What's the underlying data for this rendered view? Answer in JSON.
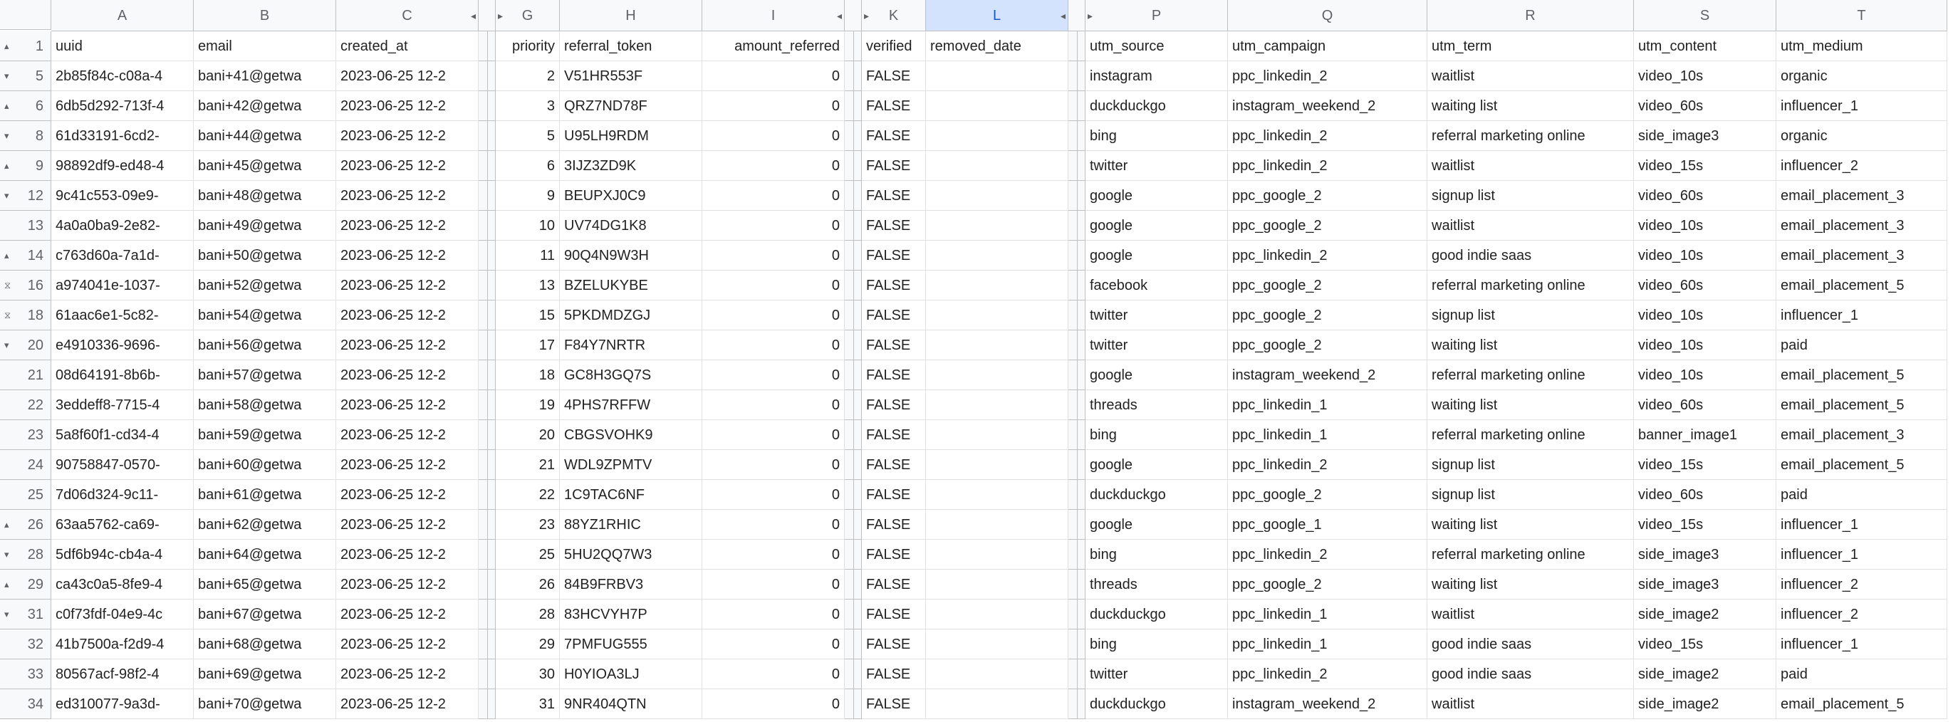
{
  "columns": [
    {
      "letter": "",
      "width": "corner"
    },
    {
      "letter": "A"
    },
    {
      "letter": "B"
    },
    {
      "letter": "C",
      "rcaret": "◂"
    },
    {
      "letter": "",
      "edge": "r"
    },
    {
      "letter": "",
      "edge": "l"
    },
    {
      "letter": "G",
      "lcaret": "▸"
    },
    {
      "letter": "H"
    },
    {
      "letter": "I",
      "rcaret": "◂"
    },
    {
      "letter": "",
      "edge": "r"
    },
    {
      "letter": "",
      "edge": "l"
    },
    {
      "letter": "K",
      "lcaret": "▸"
    },
    {
      "letter": "L",
      "rcaret": "◂",
      "selected": true
    },
    {
      "letter": "",
      "edge": "r"
    },
    {
      "letter": "",
      "edge": "l"
    },
    {
      "letter": "P",
      "lcaret": "▸"
    },
    {
      "letter": "Q"
    },
    {
      "letter": "R"
    },
    {
      "letter": "S"
    },
    {
      "letter": "T"
    }
  ],
  "rows": [
    {
      "num": "1",
      "mark": "▴",
      "cells": [
        "uuid",
        "email",
        "created_at",
        "",
        "",
        "priority",
        "referral_token",
        "amount_referred",
        "",
        "",
        "verified",
        "removed_date",
        "",
        "",
        "utm_source",
        "utm_campaign",
        "utm_term",
        "utm_content",
        "utm_medium"
      ]
    },
    {
      "num": "5",
      "mark": "▾",
      "cells": [
        "2b85f84c-c08a-4",
        "bani+41@getwa",
        "2023-06-25 12-2",
        "",
        "",
        "2",
        "V51HR553F",
        "0",
        "",
        "",
        "FALSE",
        "",
        "",
        "",
        "instagram",
        "ppc_linkedin_2",
        "waitlist",
        "video_10s",
        "organic"
      ]
    },
    {
      "num": "6",
      "mark": "▴",
      "cells": [
        "6db5d292-713f-4",
        "bani+42@getwa",
        "2023-06-25 12-2",
        "",
        "",
        "3",
        "QRZ7ND78F",
        "0",
        "",
        "",
        "FALSE",
        "",
        "",
        "",
        "duckduckgo",
        "instagram_weekend_2",
        "waiting list",
        "video_60s",
        "influencer_1"
      ]
    },
    {
      "num": "8",
      "mark": "▾",
      "cells": [
        "61d33191-6cd2-",
        "bani+44@getwa",
        "2023-06-25 12-2",
        "",
        "",
        "5",
        "U95LH9RDM",
        "0",
        "",
        "",
        "FALSE",
        "",
        "",
        "",
        "bing",
        "ppc_linkedin_2",
        "referral marketing online",
        "side_image3",
        "organic"
      ]
    },
    {
      "num": "9",
      "mark": "▴",
      "cells": [
        "98892df9-ed48-4",
        "bani+45@getwa",
        "2023-06-25 12-2",
        "",
        "",
        "6",
        "3IJZ3ZD9K",
        "0",
        "",
        "",
        "FALSE",
        "",
        "",
        "",
        "twitter",
        "ppc_linkedin_2",
        "waitlist",
        "video_15s",
        "influencer_2"
      ]
    },
    {
      "num": "12",
      "mark": "▾",
      "cells": [
        "9c41c553-09e9-",
        "bani+48@getwa",
        "2023-06-25 12-2",
        "",
        "",
        "9",
        "BEUPXJ0C9",
        "0",
        "",
        "",
        "FALSE",
        "",
        "",
        "",
        "google",
        "ppc_google_2",
        "signup list",
        "video_60s",
        "email_placement_3"
      ]
    },
    {
      "num": "13",
      "mark": "",
      "cells": [
        "4a0a0ba9-2e82-",
        "bani+49@getwa",
        "2023-06-25 12-2",
        "",
        "",
        "10",
        "UV74DG1K8",
        "0",
        "",
        "",
        "FALSE",
        "",
        "",
        "",
        "google",
        "ppc_google_2",
        "waitlist",
        "video_10s",
        "email_placement_3"
      ]
    },
    {
      "num": "14",
      "mark": "▴",
      "cells": [
        "c763d60a-7a1d-",
        "bani+50@getwa",
        "2023-06-25 12-2",
        "",
        "",
        "11",
        "90Q4N9W3H",
        "0",
        "",
        "",
        "FALSE",
        "",
        "",
        "",
        "google",
        "ppc_linkedin_2",
        "good indie saas",
        "video_10s",
        "email_placement_3"
      ]
    },
    {
      "num": "16",
      "mark": "⧖",
      "cells": [
        "a974041e-1037-",
        "bani+52@getwa",
        "2023-06-25 12-2",
        "",
        "",
        "13",
        "BZELUKYBE",
        "0",
        "",
        "",
        "FALSE",
        "",
        "",
        "",
        "facebook",
        "ppc_google_2",
        "referral marketing online",
        "video_60s",
        "email_placement_5"
      ]
    },
    {
      "num": "18",
      "mark": "⧖",
      "cells": [
        "61aac6e1-5c82-",
        "bani+54@getwa",
        "2023-06-25 12-2",
        "",
        "",
        "15",
        "5PKDMDZGJ",
        "0",
        "",
        "",
        "FALSE",
        "",
        "",
        "",
        "twitter",
        "ppc_google_2",
        "signup list",
        "video_10s",
        "influencer_1"
      ]
    },
    {
      "num": "20",
      "mark": "▾",
      "cells": [
        "e4910336-9696-",
        "bani+56@getwa",
        "2023-06-25 12-2",
        "",
        "",
        "17",
        "F84Y7NRTR",
        "0",
        "",
        "",
        "FALSE",
        "",
        "",
        "",
        "twitter",
        "ppc_google_2",
        "waiting list",
        "video_10s",
        "paid"
      ]
    },
    {
      "num": "21",
      "mark": "",
      "cells": [
        "08d64191-8b6b-",
        "bani+57@getwa",
        "2023-06-25 12-2",
        "",
        "",
        "18",
        "GC8H3GQ7S",
        "0",
        "",
        "",
        "FALSE",
        "",
        "",
        "",
        "google",
        "instagram_weekend_2",
        "referral marketing online",
        "video_10s",
        "email_placement_5"
      ]
    },
    {
      "num": "22",
      "mark": "",
      "cells": [
        "3eddeff8-7715-4",
        "bani+58@getwa",
        "2023-06-25 12-2",
        "",
        "",
        "19",
        "4PHS7RFFW",
        "0",
        "",
        "",
        "FALSE",
        "",
        "",
        "",
        "threads",
        "ppc_linkedin_1",
        "waiting list",
        "video_60s",
        "email_placement_5"
      ]
    },
    {
      "num": "23",
      "mark": "",
      "cells": [
        "5a8f60f1-cd34-4",
        "bani+59@getwa",
        "2023-06-25 12-2",
        "",
        "",
        "20",
        "CBGSVOHK9",
        "0",
        "",
        "",
        "FALSE",
        "",
        "",
        "",
        "bing",
        "ppc_linkedin_1",
        "referral marketing online",
        "banner_image1",
        "email_placement_3"
      ]
    },
    {
      "num": "24",
      "mark": "",
      "cells": [
        "90758847-0570-",
        "bani+60@getwa",
        "2023-06-25 12-2",
        "",
        "",
        "21",
        "WDL9ZPMTV",
        "0",
        "",
        "",
        "FALSE",
        "",
        "",
        "",
        "google",
        "ppc_linkedin_2",
        "signup list",
        "video_15s",
        "email_placement_5"
      ]
    },
    {
      "num": "25",
      "mark": "",
      "cells": [
        "7d06d324-9c11-",
        "bani+61@getwa",
        "2023-06-25 12-2",
        "",
        "",
        "22",
        "1C9TAC6NF",
        "0",
        "",
        "",
        "FALSE",
        "",
        "",
        "",
        "duckduckgo",
        "ppc_google_2",
        "signup list",
        "video_60s",
        "paid"
      ]
    },
    {
      "num": "26",
      "mark": "▴",
      "cells": [
        "63aa5762-ca69-",
        "bani+62@getwa",
        "2023-06-25 12-2",
        "",
        "",
        "23",
        "88YZ1RHIC",
        "0",
        "",
        "",
        "FALSE",
        "",
        "",
        "",
        "google",
        "ppc_google_1",
        "waiting list",
        "video_15s",
        "influencer_1"
      ]
    },
    {
      "num": "28",
      "mark": "▾",
      "cells": [
        "5df6b94c-cb4a-4",
        "bani+64@getwa",
        "2023-06-25 12-2",
        "",
        "",
        "25",
        "5HU2QQ7W3",
        "0",
        "",
        "",
        "FALSE",
        "",
        "",
        "",
        "bing",
        "ppc_linkedin_2",
        "referral marketing online",
        "side_image3",
        "influencer_1"
      ]
    },
    {
      "num": "29",
      "mark": "▴",
      "cells": [
        "ca43c0a5-8fe9-4",
        "bani+65@getwa",
        "2023-06-25 12-2",
        "",
        "",
        "26",
        "84B9FRBV3",
        "0",
        "",
        "",
        "FALSE",
        "",
        "",
        "",
        "threads",
        "ppc_google_2",
        "waiting list",
        "side_image3",
        "influencer_2"
      ]
    },
    {
      "num": "31",
      "mark": "▾",
      "cells": [
        "c0f73fdf-04e9-4c",
        "bani+67@getwa",
        "2023-06-25 12-2",
        "",
        "",
        "28",
        "83HCVYH7P",
        "0",
        "",
        "",
        "FALSE",
        "",
        "",
        "",
        "duckduckgo",
        "ppc_linkedin_1",
        "waitlist",
        "side_image2",
        "influencer_2"
      ]
    },
    {
      "num": "32",
      "mark": "",
      "cells": [
        "41b7500a-f2d9-4",
        "bani+68@getwa",
        "2023-06-25 12-2",
        "",
        "",
        "29",
        "7PMFUG555",
        "0",
        "",
        "",
        "FALSE",
        "",
        "",
        "",
        "bing",
        "ppc_linkedin_1",
        "good indie saas",
        "video_15s",
        "influencer_1"
      ]
    },
    {
      "num": "33",
      "mark": "",
      "cells": [
        "80567acf-98f2-4",
        "bani+69@getwa",
        "2023-06-25 12-2",
        "",
        "",
        "30",
        "H0YIOA3LJ",
        "0",
        "",
        "",
        "FALSE",
        "",
        "",
        "",
        "twitter",
        "ppc_linkedin_2",
        "good indie saas",
        "side_image2",
        "paid"
      ]
    },
    {
      "num": "34",
      "mark": "",
      "cells": [
        "ed310077-9a3d-",
        "bani+70@getwa",
        "2023-06-25 12-2",
        "",
        "",
        "31",
        "9NR404QTN",
        "0",
        "",
        "",
        "FALSE",
        "",
        "",
        "",
        "duckduckgo",
        "instagram_weekend_2",
        "waitlist",
        "side_image2",
        "email_placement_5"
      ]
    }
  ],
  "numericCols": [
    5,
    7
  ]
}
